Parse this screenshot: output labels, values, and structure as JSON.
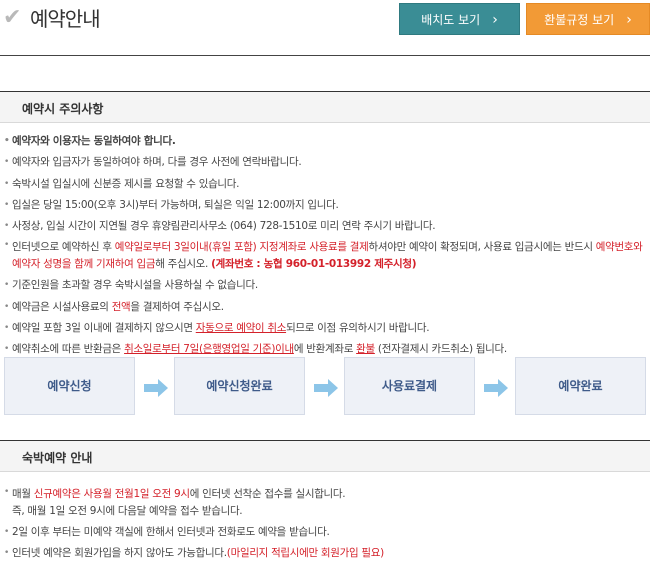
{
  "header": {
    "title": "예약안내",
    "map_button": "배치도 보기",
    "refund_button": "환불규정 보기"
  },
  "section1": {
    "title": "예약시 주의사항",
    "n1": "예약자와 이용자는 동일하여야 합니다.",
    "n2": "예약자와 입금자가 동일하여야 하며, 다를 경우 사전에 연락바랍니다.",
    "n3": "숙박시설 입실시에 신분증 제시를 요청할 수 있습니다.",
    "n4": "입실은 당일 15:00(오후 3시)부터 가능하며, 퇴실은 익일 12:00까지 입니다.",
    "n5": "사정상, 입실 시간이 지연될 경우 휴양림관리사무소 (064) 728-1510로 미리 연락 주시기 바랍니다.",
    "n6": {
      "p1": "인터넷으로 예약하신 후 ",
      "r1": "예약일로부터 3일이내(휴일 포함) 지정계좌로 사용료를 결제",
      "p2": "하셔야만 예약이 확정되며, 사용료 입금시에는 반드시 ",
      "r2": "예약번호와 예약자 성명을 함께 기재하여 입금",
      "p3": "해 주십시오. ",
      "account": "(계좌번호 : 농협 960-01-013992 제주시청)"
    },
    "n7": "기준인원을 초과할 경우 숙박시설을 사용하실 수 없습니다.",
    "n8": {
      "p1": "예약금은 시설사용료의 ",
      "r1": "전액",
      "p2": "을 결제하여 주십시오."
    },
    "n9": {
      "p1": "예약일 포함 3일 이내에 결제하지 않으시면 ",
      "r1": "자동으로 예약이 취소",
      "p2": "되므로 이점 유의하시기 바랍니다."
    },
    "n10": {
      "p1": "예약취소에 따른 반환금은 ",
      "r1": "취소일로부터 7일(은행영업일 기준)이내",
      "p2": "에 반환계좌로 ",
      "r2": "환불",
      "p3": " (전자결제시 카드취소) 됩니다."
    }
  },
  "flow": {
    "steps": [
      "예약신청",
      "예약신청완료",
      "사용료결제",
      "예약완료"
    ]
  },
  "section2": {
    "title": "숙박예약 안내",
    "n1": {
      "p1": "매월 ",
      "r1": "신규예약은 사용월 전월1일 오전 9시",
      "p2": "에 인터넷 선착순 접수를 실시합니다.",
      "line2": "즉, 매월 1일 오전 9시에 다음달 예약을 접수 받습니다."
    },
    "n2": "2일 이후 부터는 미예약 객실에 한해서 인터넷과 전화로도 예약을 받습니다.",
    "n3": {
      "p1": "인터넷 예약은 회원가입을 하지 않아도 가능합니다.",
      "r1": "(마일리지 적립시에만 회원가입 필요)"
    }
  },
  "colors": {
    "map_button": "#3a8d95",
    "refund_button": "#f29a36",
    "highlight": "#d4212a",
    "flow_arrow": "#8cc5e8"
  }
}
